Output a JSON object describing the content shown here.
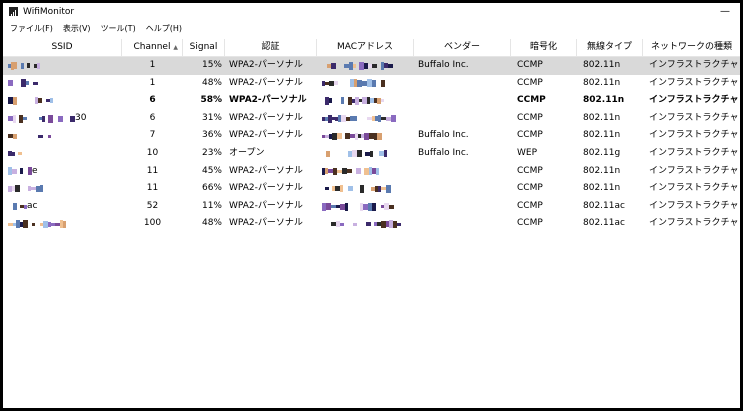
{
  "window": {
    "title": "WifiMonitor",
    "minimize": "—"
  },
  "menu": [
    "ファイル(F)",
    "表示(V)",
    "ツール(T)",
    "ヘルプ(H)"
  ],
  "columns": {
    "ssid": "SSID",
    "channel": "Channel",
    "signal": "Signal",
    "auth": "認証",
    "mac": "MACアドレス",
    "vendor": "ベンダー",
    "enc": "暗号化",
    "type": "無線タイプ",
    "net": "ネットワークの種類"
  },
  "sort_indicator": "▲",
  "rows": [
    {
      "ssid": "",
      "channel": "1",
      "signal": "15%",
      "auth": "WPA2-パーソナル",
      "vendor": "Buffalo Inc.",
      "enc": "CCMP",
      "type": "802.11n",
      "net": "インフラストラクチャ"
    },
    {
      "ssid": "",
      "channel": "1",
      "signal": "48%",
      "auth": "WPA2-パーソナル",
      "vendor": "",
      "enc": "CCMP",
      "type": "802.11n",
      "net": "インフラストラクチャ"
    },
    {
      "ssid": "",
      "channel": "6",
      "signal": "58%",
      "auth": "WPA2-パーソナル",
      "vendor": "",
      "enc": "CCMP",
      "type": "802.11n",
      "net": "インフラストラクチャ"
    },
    {
      "ssid": "30",
      "channel": "6",
      "signal": "31%",
      "auth": "WPA2-パーソナル",
      "vendor": "",
      "enc": "CCMP",
      "type": "802.11n",
      "net": "インフラストラクチャ"
    },
    {
      "ssid": "",
      "channel": "7",
      "signal": "36%",
      "auth": "WPA2-パーソナル",
      "vendor": "Buffalo Inc.",
      "enc": "CCMP",
      "type": "802.11n",
      "net": "インフラストラクチャ"
    },
    {
      "ssid": "",
      "channel": "10",
      "signal": "23%",
      "auth": "オープン",
      "vendor": "Buffalo Inc.",
      "enc": "WEP",
      "type": "802.11g",
      "net": "インフラストラクチャ"
    },
    {
      "ssid": "e",
      "channel": "11",
      "signal": "45%",
      "auth": "WPA2-パーソナル",
      "vendor": "",
      "enc": "CCMP",
      "type": "802.11n",
      "net": "インフラストラクチャ"
    },
    {
      "ssid": "",
      "channel": "11",
      "signal": "66%",
      "auth": "WPA2-パーソナル",
      "vendor": "",
      "enc": "CCMP",
      "type": "802.11n",
      "net": "インフラストラクチャ"
    },
    {
      "ssid": "ac",
      "channel": "52",
      "signal": "11%",
      "auth": "WPA2-パーソナル",
      "vendor": "",
      "enc": "CCMP",
      "type": "802.11ac",
      "net": "インフラストラクチャ"
    },
    {
      "ssid": "",
      "channel": "100",
      "signal": "48%",
      "auth": "WPA2-パーソナル",
      "vendor": "",
      "enc": "CCMP",
      "type": "802.11ac",
      "net": "インフラストラクチャ"
    }
  ],
  "selected_row": 0,
  "bold_row": 2,
  "mosaic_colors": [
    "#1a1a4a",
    "#3b2a6b",
    "#7a4a9a",
    "#c8b0e0",
    "#e8d8f0",
    "#5a7ab0",
    "#a0c0e8",
    "#d8a070",
    "#f0c090",
    "#4a3020",
    "#8a6ac0",
    "#2a2a2a"
  ]
}
